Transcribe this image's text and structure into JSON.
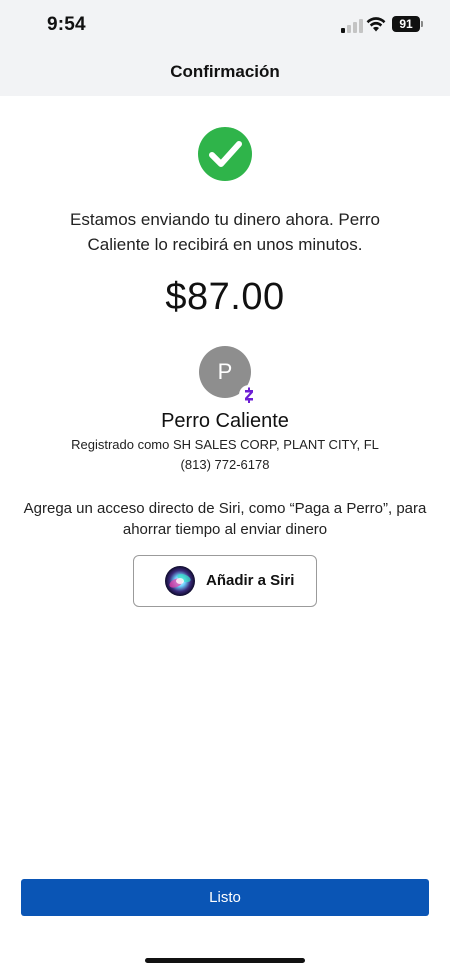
{
  "status_bar": {
    "time": "9:54",
    "battery": "91",
    "signal_icon": "cellular-signal-icon",
    "wifi_icon": "wifi-icon"
  },
  "nav": {
    "title": "Confirmación"
  },
  "confirmation": {
    "icon": "check-circle-icon",
    "icon_color": "#2fb44a",
    "message": "Estamos enviando tu dinero ahora. Perro Caliente lo recibirá en unos minutos.",
    "amount": "$87.00"
  },
  "recipient": {
    "avatar_initial": "P",
    "badge_icon": "zelle-icon",
    "badge_color": "#6d1ed4",
    "name": "Perro Caliente",
    "registered": "Registrado como SH SALES CORP, PLANT CITY, FL",
    "phone": "(813) 772-6178"
  },
  "siri": {
    "prompt": "Agrega un acceso directo de Siri, como “Paga a Perro”, para ahorrar tiempo al enviar dinero",
    "button_label": "Añadir a Siri",
    "button_icon": "siri-icon"
  },
  "footer": {
    "done_label": "Listo",
    "done_color": "#0a55b5"
  }
}
